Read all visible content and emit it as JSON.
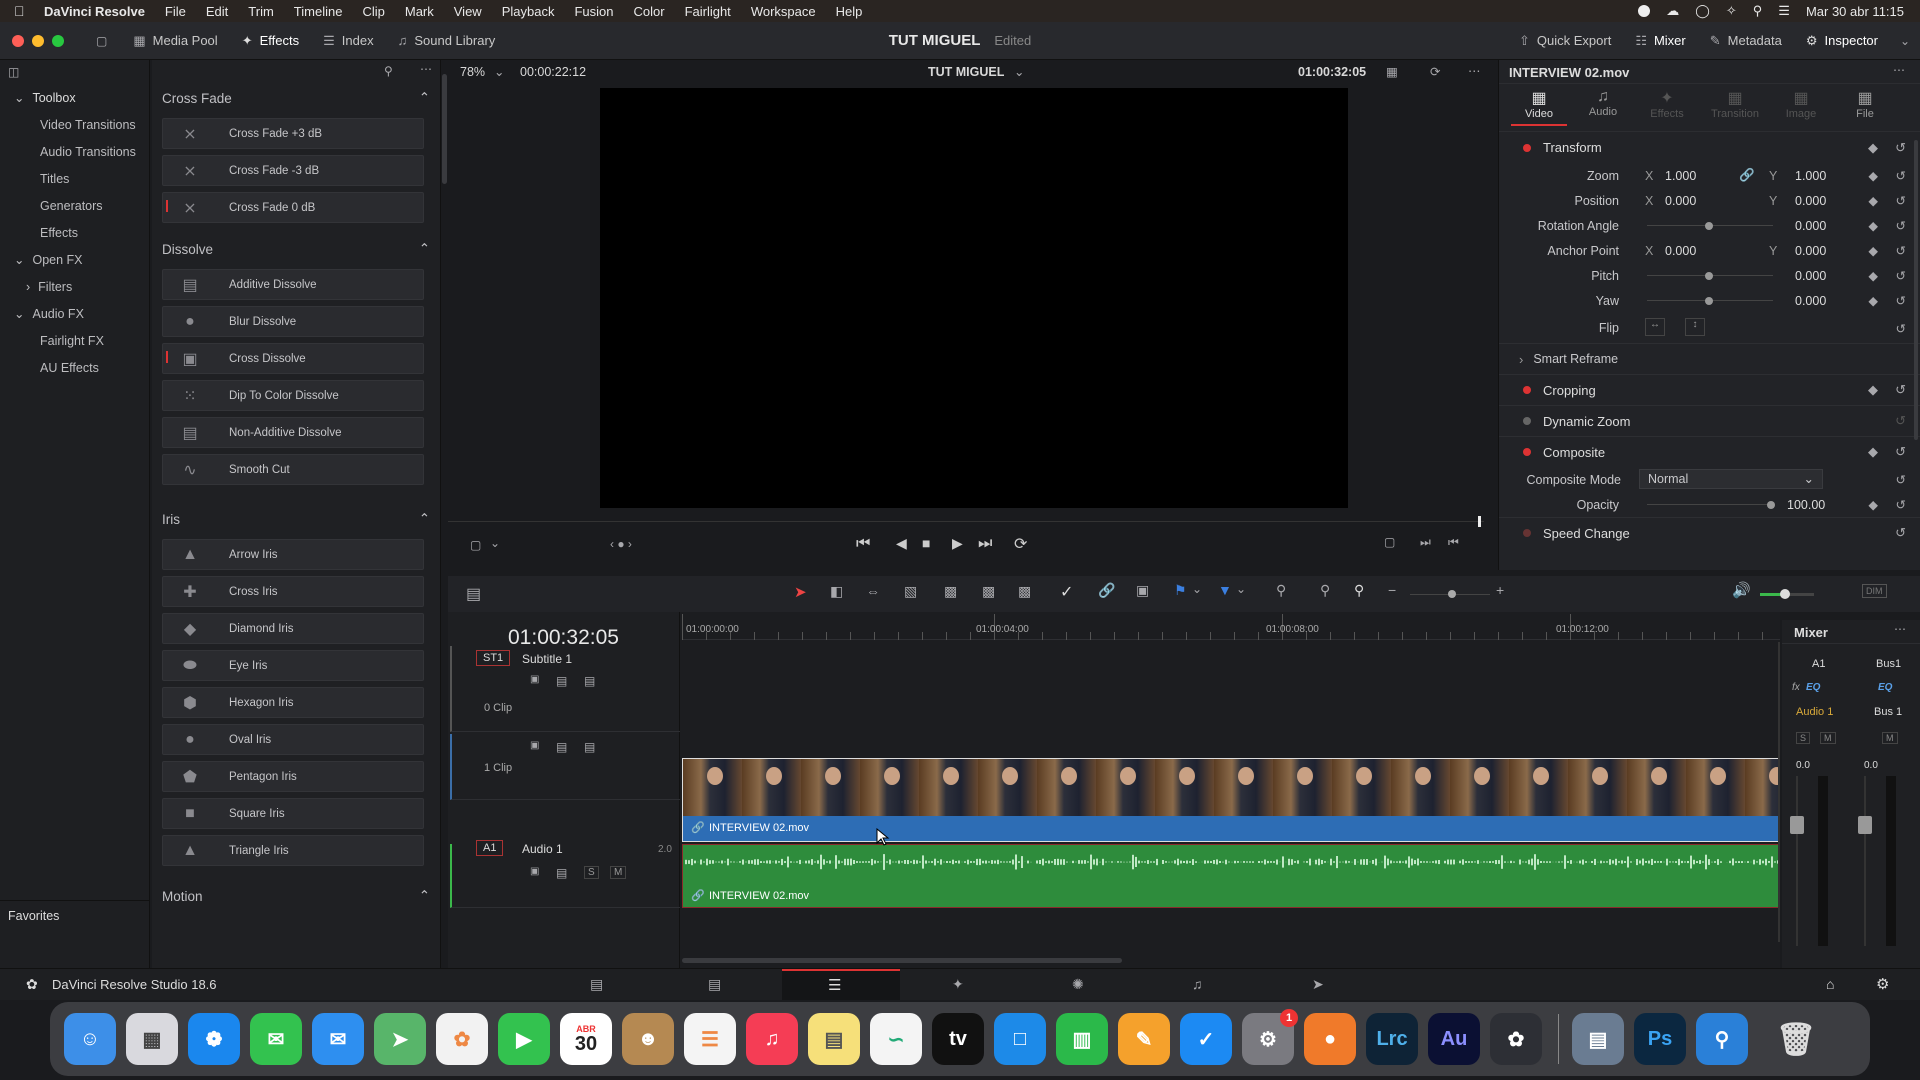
{
  "menubar": {
    "app": "DaVinci Resolve",
    "items": [
      "File",
      "Edit",
      "Trim",
      "Timeline",
      "Clip",
      "Mark",
      "View",
      "Playback",
      "Fusion",
      "Color",
      "Fairlight",
      "Workspace",
      "Help"
    ],
    "clock": "Mar 30 abr 11:15"
  },
  "toolbar": {
    "media_pool": "Media Pool",
    "effects": "Effects",
    "index": "Index",
    "sound_library": "Sound Library",
    "project": "TUT MIGUEL",
    "status": "Edited",
    "quick_export": "Quick Export",
    "mixer": "Mixer",
    "metadata": "Metadata",
    "inspector": "Inspector"
  },
  "toolbox": {
    "header": "Toolbox",
    "items": [
      "Video Transitions",
      "Audio Transitions",
      "Titles",
      "Generators",
      "Effects"
    ],
    "open_fx": "Open FX",
    "filters": "Filters",
    "audio_fx": "Audio FX",
    "fairlight_fx": "Fairlight FX",
    "au_effects": "AU Effects",
    "favorites": "Favorites"
  },
  "effects": {
    "cross_fade": {
      "title": "Cross Fade",
      "items": [
        "Cross Fade +3 dB",
        "Cross Fade -3 dB",
        "Cross Fade 0 dB"
      ]
    },
    "dissolve": {
      "title": "Dissolve",
      "items": [
        "Additive Dissolve",
        "Blur Dissolve",
        "Cross Dissolve",
        "Dip To Color Dissolve",
        "Non-Additive Dissolve",
        "Smooth Cut"
      ]
    },
    "iris": {
      "title": "Iris",
      "items": [
        "Arrow Iris",
        "Cross Iris",
        "Diamond Iris",
        "Eye Iris",
        "Hexagon Iris",
        "Oval Iris",
        "Pentagon Iris",
        "Square Iris",
        "Triangle Iris"
      ]
    },
    "motion": {
      "title": "Motion"
    }
  },
  "viewer": {
    "zoom": "78%",
    "duration": "00:00:22:12",
    "timeline_name": "TUT MIGUEL",
    "timecode": "01:00:32:05"
  },
  "inspector": {
    "clip": "INTERVIEW 02.mov",
    "tabs": [
      "Video",
      "Audio",
      "Effects",
      "Transition",
      "Image",
      "File"
    ],
    "transform": "Transform",
    "zoom_label": "Zoom",
    "zoom_x": "1.000",
    "zoom_y": "1.000",
    "position_label": "Position",
    "pos_x": "0.000",
    "pos_y": "0.000",
    "rotation_label": "Rotation Angle",
    "rotation": "0.000",
    "anchor_label": "Anchor Point",
    "anchor_x": "0.000",
    "anchor_y": "0.000",
    "pitch_label": "Pitch",
    "pitch": "0.000",
    "yaw_label": "Yaw",
    "yaw": "0.000",
    "flip_label": "Flip",
    "smart_reframe": "Smart Reframe",
    "cropping": "Cropping",
    "dynamic_zoom": "Dynamic Zoom",
    "composite": "Composite",
    "composite_mode_label": "Composite Mode",
    "composite_mode": "Normal",
    "opacity_label": "Opacity",
    "opacity": "100.00",
    "speed_change": "Speed Change",
    "x": "X",
    "y": "Y"
  },
  "timeline": {
    "timecode": "01:00:32:05",
    "ruler": [
      "01:00:00:00",
      "01:00:04:00",
      "01:00:08:00",
      "01:00:12:00"
    ],
    "st1": "ST1",
    "subtitle": "Subtitle 1",
    "clips0": "0 Clip",
    "clips1": "1 Clip",
    "a1": "A1",
    "audio1": "Audio 1",
    "audio_ch": "2.0",
    "video_clip": "INTERVIEW 02.mov",
    "audio_clip": "INTERVIEW 02.mov"
  },
  "mixer": {
    "title": "Mixer",
    "a1": "A1",
    "bus1": "Bus1",
    "audio1": "Audio 1",
    "bus1b": "Bus 1",
    "db_a": "0.0",
    "db_b": "0.0",
    "s": "S",
    "m": "M",
    "fx": "fx",
    "eq": "EQ",
    "eq2": "EQ"
  },
  "bottombar": {
    "app": "DaVinci Resolve Studio 18.6"
  },
  "dock": {
    "calendar_month": "ABR",
    "calendar_day": "30",
    "badge": "1",
    "lrc": "Lrc",
    "au": "Au",
    "ps": "Ps",
    "tv": "tv"
  }
}
